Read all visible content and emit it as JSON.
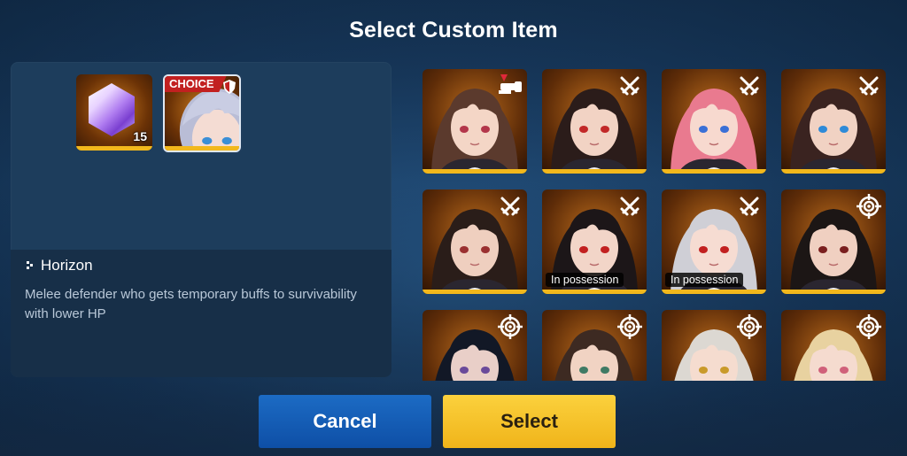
{
  "dialog": {
    "title": "Select Custom Item"
  },
  "selected": {
    "items": [
      {
        "name": "crystal",
        "quantity": "15"
      },
      {
        "name": "character",
        "tag": "CHOICE",
        "class_icon": "shield-icon"
      }
    ],
    "character_name": "Horizon",
    "description": "Melee defender who gets temporary buffs to survivability with lower HP"
  },
  "grid": {
    "cards": [
      {
        "hair": "#5b3a2d",
        "skin": "#f4d6c6",
        "eye": "#b3364a",
        "class_icon": "cannon-icon",
        "possession": ""
      },
      {
        "hair": "#2b1c1a",
        "skin": "#f2d3c4",
        "eye": "#c22828",
        "class_icon": "crossed-swords-icon",
        "possession": ""
      },
      {
        "hair": "#e97a8f",
        "skin": "#f7d9cf",
        "eye": "#3a6fd6",
        "class_icon": "crossed-swords-icon",
        "possession": ""
      },
      {
        "hair": "#3a2320",
        "skin": "#f1d2c3",
        "eye": "#2e8ad8",
        "class_icon": "crossed-swords-icon",
        "possession": ""
      },
      {
        "hair": "#2a1d19",
        "skin": "#efcfbf",
        "eye": "#9a3030",
        "class_icon": "crossed-swords-icon",
        "possession": ""
      },
      {
        "hair": "#1c1618",
        "skin": "#f2d5c8",
        "eye": "#c22020",
        "class_icon": "crossed-swords-icon",
        "possession": "In possession"
      },
      {
        "hair": "#cfcfd6",
        "skin": "#f6dcd2",
        "eye": "#c22020",
        "class_icon": "crossed-swords-icon",
        "possession": "In possession"
      },
      {
        "hair": "#1c1615",
        "skin": "#f0d0c1",
        "eye": "#7a1f1f",
        "class_icon": "crosshair-icon",
        "possession": ""
      },
      {
        "hair": "#121826",
        "skin": "#e9cfc8",
        "eye": "#6a4a9a",
        "class_icon": "crosshair-icon",
        "possession": ""
      },
      {
        "hair": "#3d2a22",
        "skin": "#f1d3c3",
        "eye": "#3f7a64",
        "class_icon": "crosshair-icon",
        "possession": ""
      },
      {
        "hair": "#dcd8d2",
        "skin": "#f5dccf",
        "eye": "#c99a2a",
        "class_icon": "crosshair-icon",
        "possession": ""
      },
      {
        "hair": "#e8d2a0",
        "skin": "#f5dbcf",
        "eye": "#d0607a",
        "class_icon": "crosshair-icon",
        "possession": ""
      }
    ]
  },
  "buttons": {
    "cancel": "Cancel",
    "select": "Select"
  },
  "colors": {
    "gold": "#f2b81c",
    "choice_red": "#c22020",
    "cancel_blue": "#0e4fa6"
  }
}
